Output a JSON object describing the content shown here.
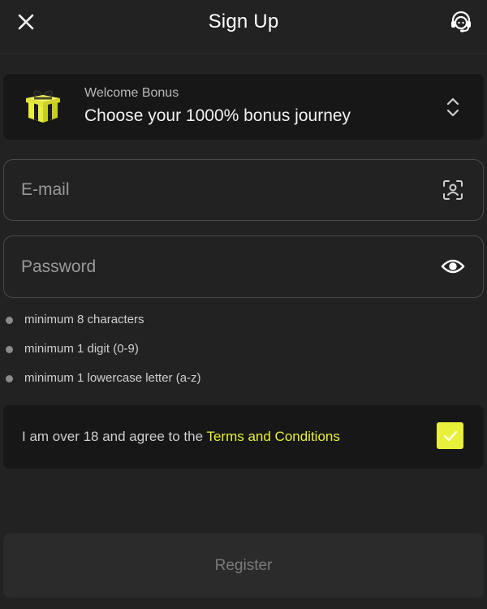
{
  "header": {
    "title": "Sign Up",
    "close_icon": "close-icon",
    "support_icon": "headset-support-icon"
  },
  "bonus": {
    "label": "Welcome Bonus",
    "value": "Choose your 1000% bonus journey",
    "icon": "gift-icon",
    "chevron_icon": "chevron-up-down-icon"
  },
  "form": {
    "email": {
      "placeholder": "E-mail",
      "value": "",
      "icon": "face-scan-icon"
    },
    "password": {
      "placeholder": "Password",
      "value": "",
      "icon": "eye-icon"
    }
  },
  "requirements": [
    "minimum 8 characters",
    "minimum 1 digit (0-9)",
    "minimum 1 lowercase letter (a-z)"
  ],
  "terms": {
    "text": "I am over 18 and agree to the ",
    "link": "Terms and Conditions",
    "checked": true
  },
  "register": {
    "label": "Register"
  },
  "colors": {
    "background": "#222222",
    "card": "#171717",
    "accent": "#e8f03a",
    "border": "#4a4a4a"
  }
}
